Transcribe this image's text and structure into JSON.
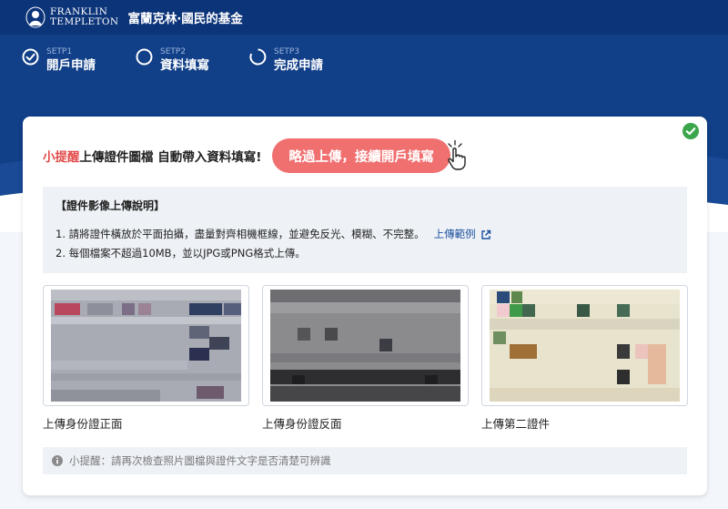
{
  "header": {
    "logo_line1": "FRANKLIN",
    "logo_line2": "TEMPLETON",
    "title": "富蘭克林‧國民的基金"
  },
  "steps": [
    {
      "num": "SETP1",
      "label": "開戶申請",
      "state": "done"
    },
    {
      "num": "SETP2",
      "label": "資料填寫",
      "state": "current"
    },
    {
      "num": "SETP3",
      "label": "完成申請",
      "state": "pending"
    }
  ],
  "tip": {
    "lead": "小提醒",
    "text": "上傳證件圖檔 自動帶入資料填寫!",
    "skip_button": "略過上傳，接續開戶填寫"
  },
  "instructions": {
    "title": "【證件影像上傳說明】",
    "line1": "1. 請將證件橫放於平面拍攝，盡量對齊相機框線，並避免反光、模糊、不完整。",
    "example_link": "上傳範例",
    "line2": "2. 每個檔案不超過10MB，並以JPG或PNG格式上傳。"
  },
  "uploads": [
    {
      "label": "上傳身份證正面"
    },
    {
      "label": "上傳身份證反面"
    },
    {
      "label": "上傳第二證件"
    }
  ],
  "note": {
    "text": "小提醒：請再次檢查照片圖檔與證件文字是否清楚可辨識"
  },
  "colors": {
    "header_bg": "#0c3479",
    "hero_bg": "#113f88",
    "accent_red": "#e34b4b",
    "button_bg": "#f06f6f",
    "success_green": "#3aa54a",
    "link_blue": "#1b4f9c"
  }
}
